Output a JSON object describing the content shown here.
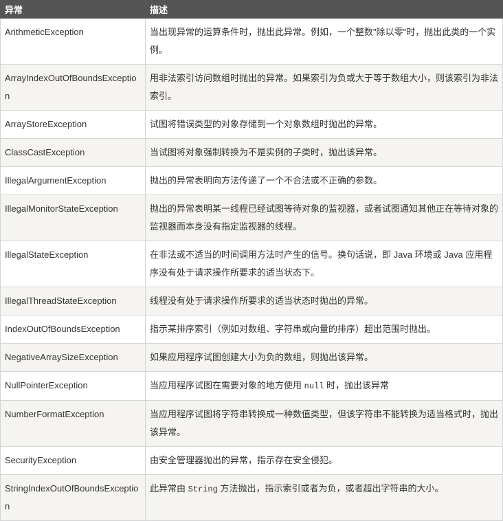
{
  "header": {
    "col1": "异常",
    "col2": "描述"
  },
  "rows": [
    {
      "name": "ArithmeticException",
      "desc": "当出现异常的运算条件时，抛出此异常。例如，一个整数\"除以零\"时，抛出此类的一个实例。"
    },
    {
      "name": "ArrayIndexOutOfBoundsException",
      "desc": "用非法索引访问数组时抛出的异常。如果索引为负或大于等于数组大小，则该索引为非法索引。"
    },
    {
      "name": "ArrayStoreException",
      "desc": "试图将错误类型的对象存储到一个对象数组时抛出的异常。"
    },
    {
      "name": "ClassCastException",
      "desc": "当试图将对象强制转换为不是实例的子类时，抛出该异常。"
    },
    {
      "name": "IllegalArgumentException",
      "desc": "抛出的异常表明向方法传递了一个不合法或不正确的参数。"
    },
    {
      "name": "IllegalMonitorStateException",
      "desc": "抛出的异常表明某一线程已经试图等待对象的监视器，或者试图通知其他正在等待对象的监视器而本身没有指定监视器的线程。"
    },
    {
      "name": "IllegalStateException",
      "desc": "在非法或不适当的时间调用方法时产生的信号。换句话说，即 Java 环境或 Java 应用程序没有处于请求操作所要求的适当状态下。"
    },
    {
      "name": "IllegalThreadStateException",
      "desc": "线程没有处于请求操作所要求的适当状态时抛出的异常。"
    },
    {
      "name": "IndexOutOfBoundsException",
      "desc": "指示某排序索引（例如对数组、字符串或向量的排序）超出范围时抛出。"
    },
    {
      "name": "NegativeArraySizeException",
      "desc": "如果应用程序试图创建大小为负的数组，则抛出该异常。"
    },
    {
      "name": "NullPointerException",
      "desc_pre": "当应用程序试图在需要对象的地方使用 ",
      "desc_code": "null",
      "desc_post": " 时，抛出该异常"
    },
    {
      "name": "NumberFormatException",
      "desc": "当应用程序试图将字符串转换成一种数值类型，但该字符串不能转换为适当格式时，抛出该异常。"
    },
    {
      "name": "SecurityException",
      "desc": "由安全管理器抛出的异常，指示存在安全侵犯。"
    },
    {
      "name": "StringIndexOutOfBoundsException",
      "desc_pre": "此异常由 ",
      "desc_code": "String",
      "desc_post": " 方法抛出，指示索引或者为负，或者超出字符串的大小。"
    }
  ]
}
